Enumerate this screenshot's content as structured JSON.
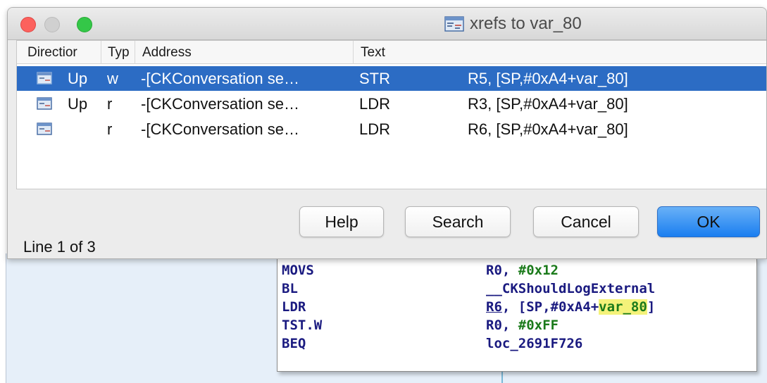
{
  "window": {
    "title": "xrefs to var_80"
  },
  "list": {
    "headers": [
      "Directior",
      "Typ",
      "Address",
      "Text"
    ],
    "rows": [
      {
        "direction": "Up",
        "type": "w",
        "address": "-[CKConversation se…",
        "mnemonic": "STR",
        "operands": "R5, [SP,#0xA4+var_80]",
        "selected": true
      },
      {
        "direction": "Up",
        "type": "r",
        "address": "-[CKConversation se…",
        "mnemonic": "LDR",
        "operands": "R3, [SP,#0xA4+var_80]",
        "selected": false
      },
      {
        "direction": "",
        "type": "r",
        "address": "-[CKConversation se…",
        "mnemonic": "LDR",
        "operands": "R6, [SP,#0xA4+var_80]",
        "selected": false
      }
    ]
  },
  "buttons": {
    "help": "Help",
    "search": "Search",
    "cancel": "Cancel",
    "ok": "OK"
  },
  "status": "Line 1 of 3",
  "code": {
    "rows": [
      {
        "mnemonic": "MOVS",
        "reg": "R0, ",
        "value": "#0x12"
      },
      {
        "mnemonic": "BL",
        "target": "__CKShouldLogExternal"
      },
      {
        "mnemonic": "LDR",
        "reg": "R6",
        "mid": ", [SP,#0xA4+",
        "var": "var_80",
        "tail": "]"
      },
      {
        "mnemonic": "TST.W",
        "reg": "R0, ",
        "value": "#0xFF"
      },
      {
        "mnemonic": "BEQ",
        "target": "loc_2691F726"
      }
    ]
  },
  "colors": {
    "selection": "#2c6cc4",
    "ok_button": "#1a7ef0",
    "code_text": "#1a1a80",
    "code_number": "#1a7a1a",
    "highlight": "#f4f27a"
  },
  "icons": {
    "xref_row_icon": "xref-icon",
    "title_icon": "xref-window-icon"
  }
}
